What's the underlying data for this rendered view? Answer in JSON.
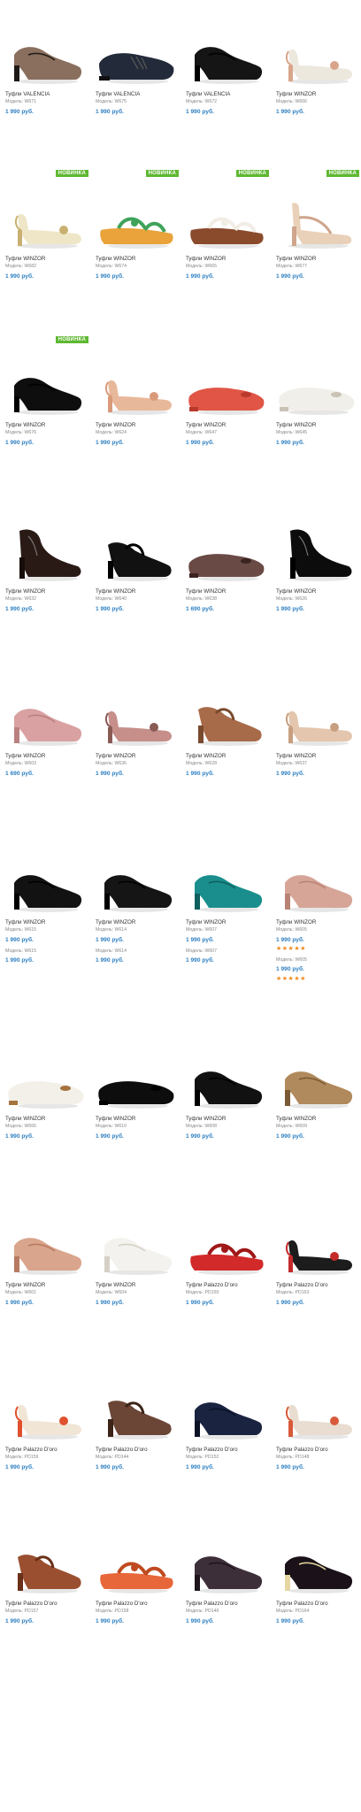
{
  "badge_text": "НОВИНКА",
  "colors": {
    "price": "#2d7fc2",
    "badge": "#5fb832",
    "stars": "#f08b1d"
  },
  "rows": [
    [
      {
        "title": "Туфли VALENCIA",
        "model": "Модель: W671",
        "price": "1 990 руб.",
        "shoe": "pump",
        "c1": "#8a6f5e",
        "c2": "#1f1a17"
      },
      {
        "title": "Туфли VALENCIA",
        "model": "Модель: W675",
        "price": "1 990 руб.",
        "shoe": "loafer",
        "c1": "#232a3a",
        "c2": "#111"
      },
      {
        "title": "Туфли VALENCIA",
        "model": "Модель: W672",
        "price": "1 990 руб.",
        "shoe": "pump",
        "c1": "#151515",
        "c2": "#000"
      },
      {
        "title": "Туфли WINZOR",
        "model": "Модель: W666",
        "price": "1 990 руб.",
        "shoe": "sling",
        "c1": "#ede8de",
        "c2": "#d9a58a"
      }
    ],
    [
      {
        "title": "Туфли WINZOR",
        "model": "Модель: W682",
        "price": "1 990 руб.",
        "shoe": "sling",
        "c1": "#efe6c8",
        "c2": "#c8b070",
        "badge": true
      },
      {
        "title": "Туфли WINZOR",
        "model": "Модель: W674",
        "price": "1 990 руб.",
        "shoe": "sandal",
        "c1": "#e9a33a",
        "c2": "#3fa35a",
        "badge": true
      },
      {
        "title": "Туфли WINZOR",
        "model": "Модель: W665",
        "price": "1 990 руб.",
        "shoe": "sandal",
        "c1": "#8a4a2c",
        "c2": "#f1ede5",
        "badge": true
      },
      {
        "title": "Туфли WINZOR",
        "model": "Модель: W677",
        "price": "1 990 руб.",
        "shoe": "tstrap",
        "c1": "#e9d0b8",
        "c2": "#cfa58c",
        "badge": true
      }
    ],
    [
      {
        "title": "Туфли WINZOR",
        "model": "Модель: W676",
        "price": "1 990 руб.",
        "shoe": "pump",
        "c1": "#0e0e0e",
        "c2": "#000",
        "badge": true
      },
      {
        "title": "Туфли WINZOR",
        "model": "Модель: W624",
        "price": "1 990 руб.",
        "shoe": "sling",
        "c1": "#e8b89a",
        "c2": "#d99a7a"
      },
      {
        "title": "Туфли WINZOR",
        "model": "Модель: W647",
        "price": "1 990 руб.",
        "shoe": "flat",
        "c1": "#e05545",
        "c2": "#b83a2c"
      },
      {
        "title": "Туфли WINZOR",
        "model": "Модель: W645",
        "price": "1 990 руб.",
        "shoe": "flat",
        "c1": "#f1efe9",
        "c2": "#c9c2b5"
      }
    ],
    [
      {
        "title": "Туфли WINZOR",
        "model": "Модель: W632",
        "price": "1 990 руб.",
        "shoe": "bootie",
        "c1": "#2a1a16",
        "c2": "#160d0a"
      },
      {
        "title": "Туфли WINZOR",
        "model": "Модель: W640",
        "price": "1 990 руб.",
        "shoe": "mary",
        "c1": "#111",
        "c2": "#000"
      },
      {
        "title": "Туфли WINZOR",
        "model": "Модель: W638",
        "price": "1 690 руб.",
        "shoe": "flat",
        "c1": "#6a4a45",
        "c2": "#3a2422"
      },
      {
        "title": "Туфли WINZOR",
        "model": "Модель: W626",
        "price": "1 990 руб.",
        "shoe": "bootie",
        "c1": "#0c0c0c",
        "c2": "#000"
      }
    ],
    [
      {
        "title": "Туфли WINZOR",
        "model": "Модель: W603",
        "price": "1 690 руб.",
        "shoe": "pump",
        "c1": "#d9a1a1",
        "c2": "#b98080"
      },
      {
        "title": "Туфли WINZOR",
        "model": "Модель: W636",
        "price": "1 990 руб.",
        "shoe": "sling",
        "c1": "#c68f8a",
        "c2": "#8a5a55"
      },
      {
        "title": "Туфли WINZOR",
        "model": "Модель: W628",
        "price": "1 990 руб.",
        "shoe": "mary",
        "c1": "#a86b4a",
        "c2": "#7a4a2e"
      },
      {
        "title": "Туфли WINZOR",
        "model": "Модель: W637",
        "price": "1 990 руб.",
        "shoe": "sling",
        "c1": "#e3c6ad",
        "c2": "#c79f80"
      }
    ],
    [
      {
        "title": "Туфли WINZOR",
        "model": "Модель: W615",
        "price": "1 990 руб.",
        "shoe": "pump",
        "c1": "#121212",
        "c2": "#000",
        "extra": {
          "model": "Модель: W615",
          "price": "1 990 руб."
        }
      },
      {
        "title": "Туфли WINZOR",
        "model": "Модель: W614",
        "price": "1 990 руб.",
        "shoe": "pump",
        "c1": "#151515",
        "c2": "#000",
        "extra": {
          "model": "Модель: W614",
          "price": "1 990 руб."
        }
      },
      {
        "title": "Туфли WINZOR",
        "model": "Модель: W607",
        "price": "1 990 руб.",
        "shoe": "pump",
        "c1": "#1a8e8c",
        "c2": "#0f5f5e",
        "extra": {
          "model": "Модель: W607",
          "price": "1 990 руб."
        }
      },
      {
        "title": "Туфли WINZOR",
        "model": "Модель: W605",
        "price": "1 990 руб.",
        "shoe": "pump",
        "c1": "#d6a597",
        "c2": "#b88274",
        "stars": "★★★★★",
        "extra": {
          "model": "Модель: W605",
          "price": "1 990 руб.",
          "stars": "★★★★★"
        }
      }
    ],
    [
      {
        "title": "Туфли WINZOR",
        "model": "Модель: W666",
        "price": "1 990 руб.",
        "shoe": "flat",
        "c1": "#f3f0ea",
        "c2": "#a5733e"
      },
      {
        "title": "Туфли WINZOR",
        "model": "Модель: W610",
        "price": "1 990 руб.",
        "shoe": "flat",
        "c1": "#0d0d0d",
        "c2": "#000"
      },
      {
        "title": "Туфли WINZOR",
        "model": "Модель: W608",
        "price": "1 990 руб.",
        "shoe": "pump",
        "c1": "#111",
        "c2": "#000"
      },
      {
        "title": "Туфли WINZOR",
        "model": "Модель: W609",
        "price": "1 990 руб.",
        "shoe": "pump",
        "c1": "#b08a5c",
        "c2": "#7a5a35"
      }
    ],
    [
      {
        "title": "Туфли WINZOR",
        "model": "Модель: W601",
        "price": "1 990 руб.",
        "shoe": "pump",
        "c1": "#d9a58c",
        "c2": "#b77a60"
      },
      {
        "title": "Туфли WINZOR",
        "model": "Модель: W604",
        "price": "1 990 руб.",
        "shoe": "pump",
        "c1": "#f4f2ee",
        "c2": "#d5d0c6"
      },
      {
        "title": "Туфли Palazzo D'oro",
        "model": "Модель: PD150",
        "price": "1 990 руб.",
        "shoe": "sandal",
        "c1": "#d22a2a",
        "c2": "#a01818"
      },
      {
        "title": "Туфли Palazzo D'oro",
        "model": "Модель: PD163",
        "price": "1 990 руб.",
        "shoe": "sling",
        "c1": "#1c1c1c",
        "c2": "#c52a2a"
      }
    ],
    [
      {
        "title": "Туфли Palazzo D'oro",
        "model": "Модель: PD159",
        "price": "1 990 руб.",
        "shoe": "sling",
        "c1": "#f1e5d6",
        "c2": "#e0502c"
      },
      {
        "title": "Туфли Palazzo D'oro",
        "model": "Модель: PD144",
        "price": "1 990 руб.",
        "shoe": "mary",
        "c1": "#6b4637",
        "c2": "#3d2419"
      },
      {
        "title": "Туфли Palazzo D'oro",
        "model": "Модель: PD152",
        "price": "1 990 руб.",
        "shoe": "pump",
        "c1": "#1a2440",
        "c2": "#0c1226"
      },
      {
        "title": "Туфли Palazzo D'oro",
        "model": "Модель: PD148",
        "price": "1 990 руб.",
        "shoe": "sling",
        "c1": "#e8ddd0",
        "c2": "#d85a3a"
      }
    ],
    [
      {
        "title": "Туфли Palazzo D'oro",
        "model": "Модель: PD157",
        "price": "1 990 руб.",
        "shoe": "mary",
        "c1": "#9a5030",
        "c2": "#6a3018"
      },
      {
        "title": "Туфли Palazzo D'oro",
        "model": "Модель: PD158",
        "price": "1 990 руб.",
        "shoe": "sandal",
        "c1": "#e8673a",
        "c2": "#c04a20"
      },
      {
        "title": "Туфли Palazzo D'oro",
        "model": "Модель: PD146",
        "price": "1 990 руб.",
        "shoe": "pump",
        "c1": "#3d2f3a",
        "c2": "#1d141c"
      },
      {
        "title": "Туфли Palazzo D'oro",
        "model": "Модель: PD164",
        "price": "1 990 руб.",
        "shoe": "pump",
        "c1": "#1a1218",
        "c2": "#e5d6a2"
      }
    ]
  ]
}
